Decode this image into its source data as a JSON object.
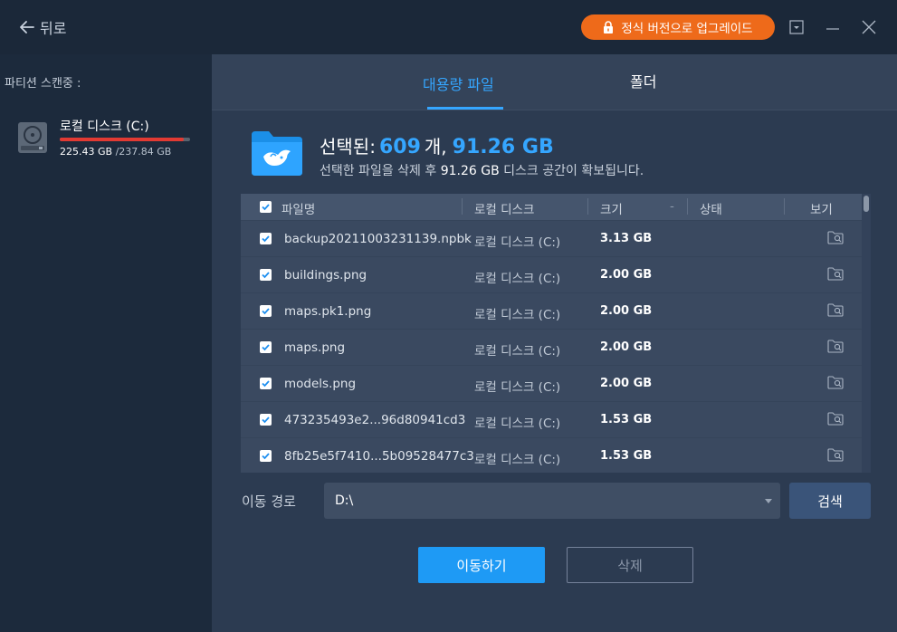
{
  "titlebar": {
    "back_label": "뒤로",
    "upgrade_label": "정식 버전으로 업그레이드"
  },
  "sidebar": {
    "label": "파티션 스캔중 :",
    "disk": {
      "name": "로컬 디스크 (C:)",
      "used": "225.43 GB",
      "total": "/237.84 GB",
      "used_fraction": 0.948
    }
  },
  "tabs": [
    {
      "label": "대용량 파일",
      "active": true
    },
    {
      "label": "폴더",
      "active": false
    }
  ],
  "summary": {
    "title_prefix": "선택된:",
    "count": "609",
    "count_unit": "개,",
    "size": "91.26 GB",
    "desc_prefix": "선택한 파일을 삭제 후",
    "desc_size": "91.26 GB",
    "desc_suffix": "디스크 공간이 확보됩니다."
  },
  "table": {
    "columns": {
      "name": "파일명",
      "disk": "로컬 디스크",
      "size": "크기",
      "sort": "-",
      "status": "상태",
      "view": "보기"
    },
    "rows": [
      {
        "name": "backup20211003231139.npbk",
        "disk": "로컬 디스크 (C:)",
        "size": "3.13 GB",
        "checked": true
      },
      {
        "name": "buildings.png",
        "disk": "로컬 디스크 (C:)",
        "size": "2.00 GB",
        "checked": true
      },
      {
        "name": "maps.pk1.png",
        "disk": "로컬 디스크 (C:)",
        "size": "2.00 GB",
        "checked": true
      },
      {
        "name": "maps.png",
        "disk": "로컬 디스크 (C:)",
        "size": "2.00 GB",
        "checked": true
      },
      {
        "name": "models.png",
        "disk": "로컬 디스크 (C:)",
        "size": "2.00 GB",
        "checked": true
      },
      {
        "name": "473235493e2...96d80941cd3",
        "disk": "로컬 디스크 (C:)",
        "size": "1.53 GB",
        "checked": true
      },
      {
        "name": "8fb25e5f7410...5b09528477c3",
        "disk": "로컬 디스크 (C:)",
        "size": "1.53 GB",
        "checked": true
      }
    ]
  },
  "destination": {
    "label": "이동 경로",
    "value": "D:\\",
    "search_label": "검색"
  },
  "actions": {
    "move_label": "이동하기",
    "delete_label": "삭제"
  },
  "colors": {
    "accent": "#35a6ff",
    "upgrade": "#ee6a1a",
    "disk_bar": "#e23a33"
  },
  "icons": {
    "back": "arrow-left-icon",
    "upgrade": "lock-icon",
    "disk": "hard-disk-icon",
    "summary": "folder-whale-icon",
    "view": "folder-search-icon"
  }
}
